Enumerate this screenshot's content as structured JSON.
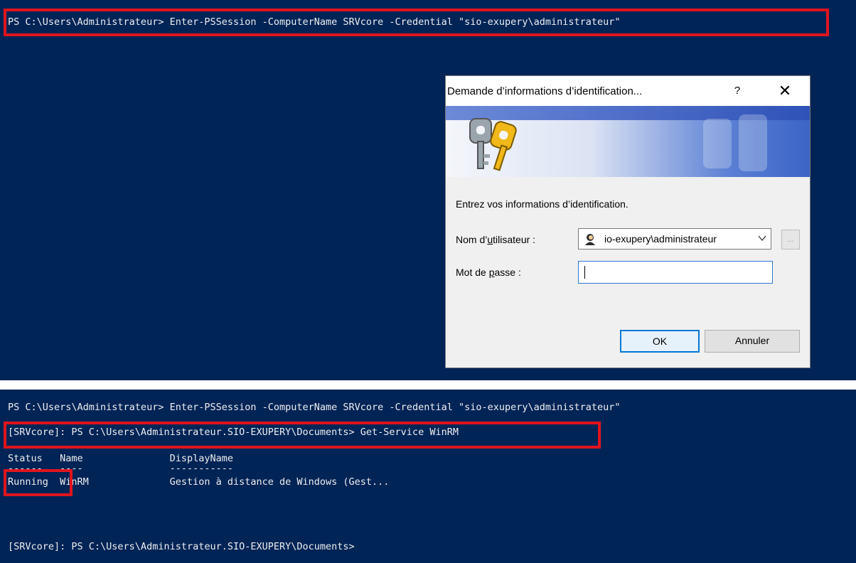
{
  "terminal_top": {
    "command": "PS C:\\Users\\Administrateur> Enter-PSSession -ComputerName SRVcore -Credential \"sio-exupery\\administrateur\""
  },
  "dialog": {
    "title": "Demande d’informations d’identification...",
    "help": "?",
    "close": "✕",
    "prompt": "Entrez vos informations d’identification.",
    "username_label_pre": "Nom d’",
    "username_label_accel": "u",
    "username_label_post": "tilisateur :",
    "username_value": "io-exupery\\administrateur",
    "browse": "...",
    "password_label_pre": "Mot de ",
    "password_label_accel": "p",
    "password_label_post": "asse :",
    "ok": "OK",
    "cancel": "Annuler"
  },
  "terminal_bottom": {
    "line1": "PS C:\\Users\\Administrateur> Enter-PSSession -ComputerName SRVcore -Credential \"sio-exupery\\administrateur\"",
    "line2": "[SRVcore]: PS C:\\Users\\Administrateur.SIO-EXUPERY\\Documents> Get-Service WinRM",
    "header": "Status   Name               DisplayName",
    "underline": "------   ----               -----------",
    "row": "Running  WinRM              Gestion à distance de Windows (Gest...",
    "prompt": "[SRVcore]: PS C:\\Users\\Administrateur.SIO-EXUPERY\\Documents>"
  },
  "colors": {
    "terminal_bg": "#012456",
    "terminal_fg": "#eeedf0",
    "highlight_box": "#e0141e",
    "ok_border": "#0078d7"
  }
}
